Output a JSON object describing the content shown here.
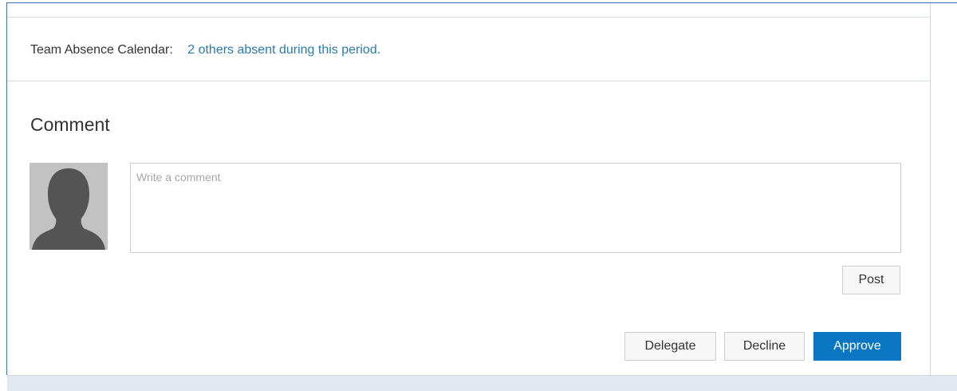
{
  "team_absence": {
    "label": "Team Absence Calendar:",
    "link_text": "2 others absent during this period."
  },
  "comment": {
    "heading": "Comment",
    "placeholder": "Write a comment",
    "avatar_icon": "person-silhouette-icon"
  },
  "actions": {
    "post_label": "Post",
    "delegate_label": "Delegate",
    "decline_label": "Decline",
    "approve_label": "Approve"
  },
  "colors": {
    "accent": "#0a76c3",
    "link": "#2a7ab0",
    "frame_border": "#3b73b9",
    "footer_bg": "#e2e8ef"
  }
}
